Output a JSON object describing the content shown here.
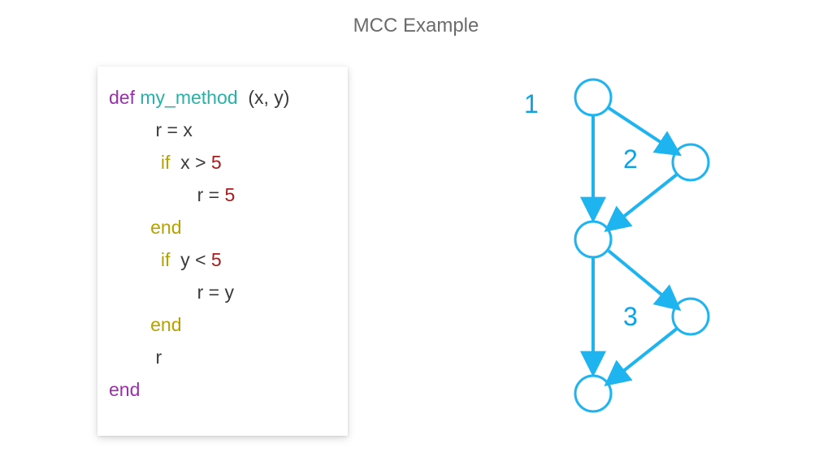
{
  "title": "MCC Example",
  "code": {
    "def": "def",
    "method_name": "my_method",
    "params": "  (x, y)",
    "line_r_eq_x": "         r = x",
    "if1_kw": "          if",
    "if1_cond_pre": "  x > ",
    "if1_num": "5",
    "line_r5_pre": "                 r = ",
    "line_r5_num": "5",
    "end1": "        end",
    "if2_kw": "          if",
    "if2_cond_pre": "  y < ",
    "if2_num": "5",
    "line_ry": "                 r = y",
    "end2": "        end",
    "line_r": "         r",
    "end_method": "end"
  },
  "graph": {
    "labels": {
      "one": "1",
      "two": "2",
      "three": "3"
    },
    "colors": {
      "stroke": "#1eb4f0",
      "fill_arrow": "#1eb4f0"
    }
  }
}
